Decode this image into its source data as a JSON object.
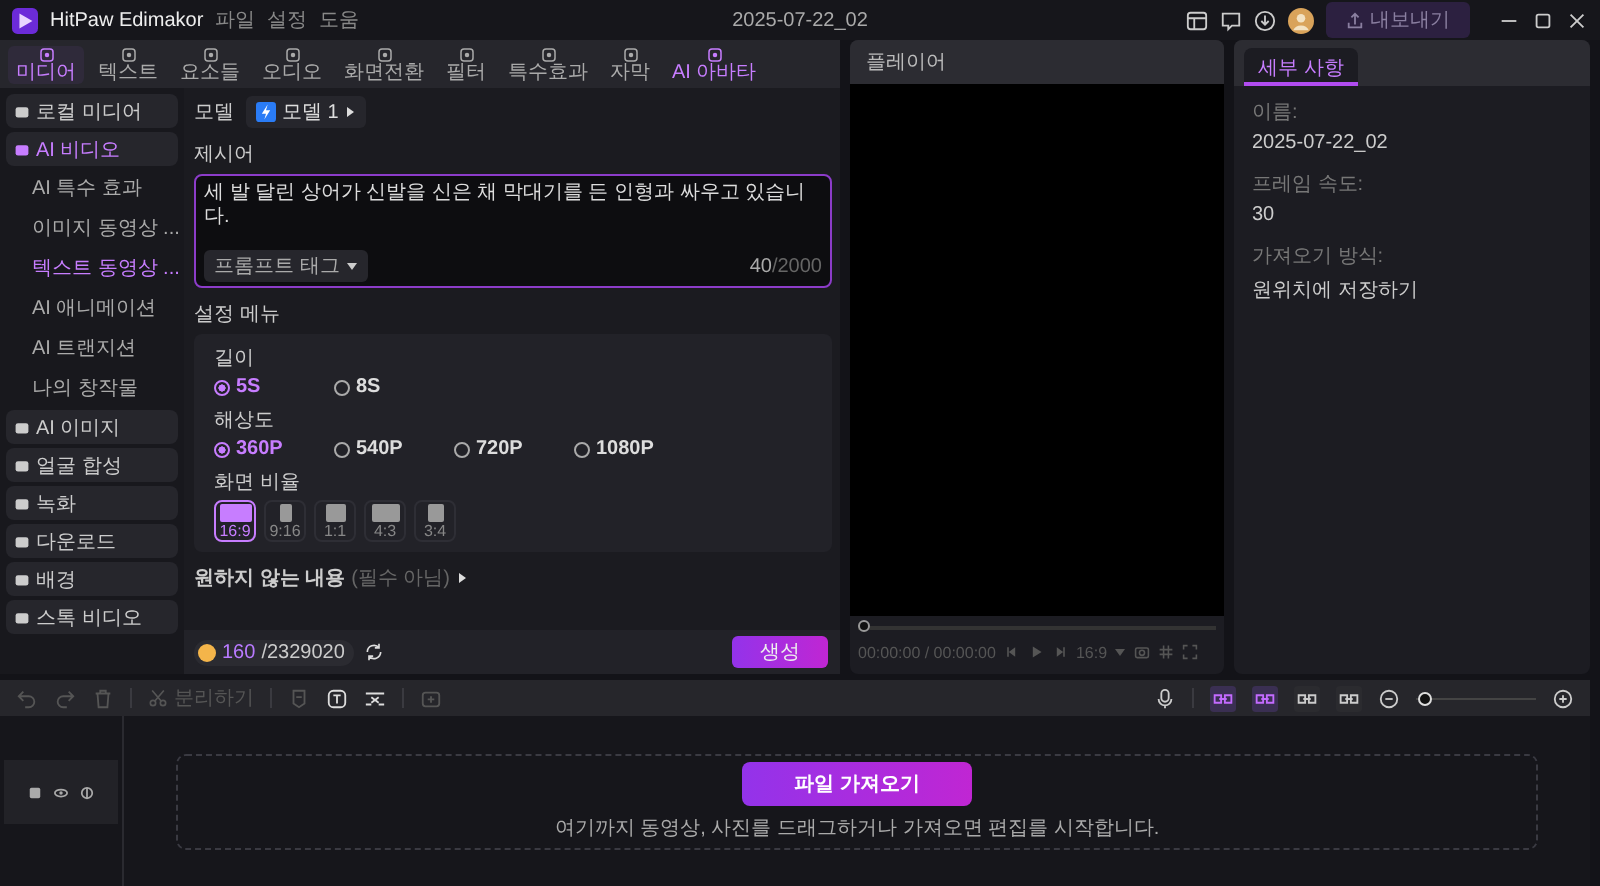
{
  "app": {
    "name": "HitPaw Edimakor",
    "menu": [
      "파일",
      "설정",
      "도움"
    ],
    "project_title": "2025-07-22_02",
    "export_label": "내보내기"
  },
  "toolbar": [
    {
      "label": "미디어",
      "selected": true,
      "highlighted": false
    },
    {
      "label": "텍스트",
      "selected": false,
      "highlighted": false
    },
    {
      "label": "요소들",
      "selected": false,
      "highlighted": false
    },
    {
      "label": "오디오",
      "selected": false,
      "highlighted": false
    },
    {
      "label": "화면전환",
      "selected": false,
      "highlighted": false
    },
    {
      "label": "필터",
      "selected": false,
      "highlighted": false
    },
    {
      "label": "특수효과",
      "selected": false,
      "highlighted": false
    },
    {
      "label": "자막",
      "selected": false,
      "highlighted": false
    },
    {
      "label": "AI 아바타",
      "selected": false,
      "highlighted": true
    }
  ],
  "sidebar": {
    "items": [
      {
        "kind": "group",
        "label": "로컬 미디어",
        "selected": false
      },
      {
        "kind": "group",
        "label": "AI 비디오",
        "selected": true,
        "children": [
          {
            "label": "AI 특수 효과",
            "selected": false
          },
          {
            "label": "이미지 동영상 ...",
            "selected": false
          },
          {
            "label": "텍스트 동영상 ...",
            "selected": true
          },
          {
            "label": "AI 애니메이션",
            "selected": false
          },
          {
            "label": "AI 트랜지션",
            "selected": false
          },
          {
            "label": "나의 창작물",
            "selected": false
          }
        ]
      },
      {
        "kind": "group",
        "label": "AI 이미지",
        "selected": false
      },
      {
        "kind": "group",
        "label": "얼굴 합성",
        "selected": false
      },
      {
        "kind": "group",
        "label": "녹화",
        "selected": false
      },
      {
        "kind": "group",
        "label": "다운로드",
        "selected": false
      },
      {
        "kind": "group",
        "label": "배경",
        "selected": false
      },
      {
        "kind": "group",
        "label": "스톡 비디오",
        "selected": false
      }
    ]
  },
  "generator": {
    "model_label": "모델",
    "model_value": "모델 1",
    "prompt_label": "제시어",
    "prompt_value": "세 발 달린 상어가 신발을 신은 채 막대기를 든 인형과 싸우고 있습니다.",
    "prompt_tag_button": "프롬프트 태그",
    "char_count": "40",
    "char_limit": "/2000",
    "settings_title": "설정 메뉴",
    "duration": {
      "label": "길이",
      "options": [
        {
          "label": "5S",
          "selected": true
        },
        {
          "label": "8S",
          "selected": false
        }
      ]
    },
    "resolution": {
      "label": "해상도",
      "options": [
        {
          "label": "360P",
          "selected": true
        },
        {
          "label": "540P",
          "selected": false
        },
        {
          "label": "720P",
          "selected": false
        },
        {
          "label": "1080P",
          "selected": false
        }
      ]
    },
    "aspect": {
      "label": "화면 비율",
      "options": [
        {
          "label": "16:9",
          "selected": true
        },
        {
          "label": "9:16",
          "selected": false
        },
        {
          "label": "1:1",
          "selected": false
        },
        {
          "label": "4:3",
          "selected": false
        },
        {
          "label": "3:4",
          "selected": false
        }
      ]
    },
    "negative_label": "원하지 않는 내용",
    "negative_hint": "(필수 아님)",
    "credits_used": "160",
    "credits_total": "/2329020",
    "generate_button": "생성"
  },
  "player": {
    "title": "플레이어",
    "time": "00:00:00 / 00:00:00",
    "ratio": "16:9",
    "progress": {
      "level": 0
    }
  },
  "details": {
    "tab": "세부 사항",
    "fields": [
      {
        "label": "이름:",
        "value": "2025-07-22_02"
      },
      {
        "label": "프레임 속도:",
        "value": "30"
      },
      {
        "label": "가져오기 방식:",
        "value": "원위치에 저장하기"
      }
    ]
  },
  "timeline": {
    "split_label": "분리하기",
    "toggles": [
      {
        "on": true
      },
      {
        "on": true
      },
      {
        "on": false
      },
      {
        "on": false
      }
    ],
    "zoom": {
      "level": 0.02
    },
    "import_button": "파일 가져오기",
    "drop_hint": "여기까지 동영상, 사진를 드래그하거나 가져오면 편집를 시작합니다."
  }
}
